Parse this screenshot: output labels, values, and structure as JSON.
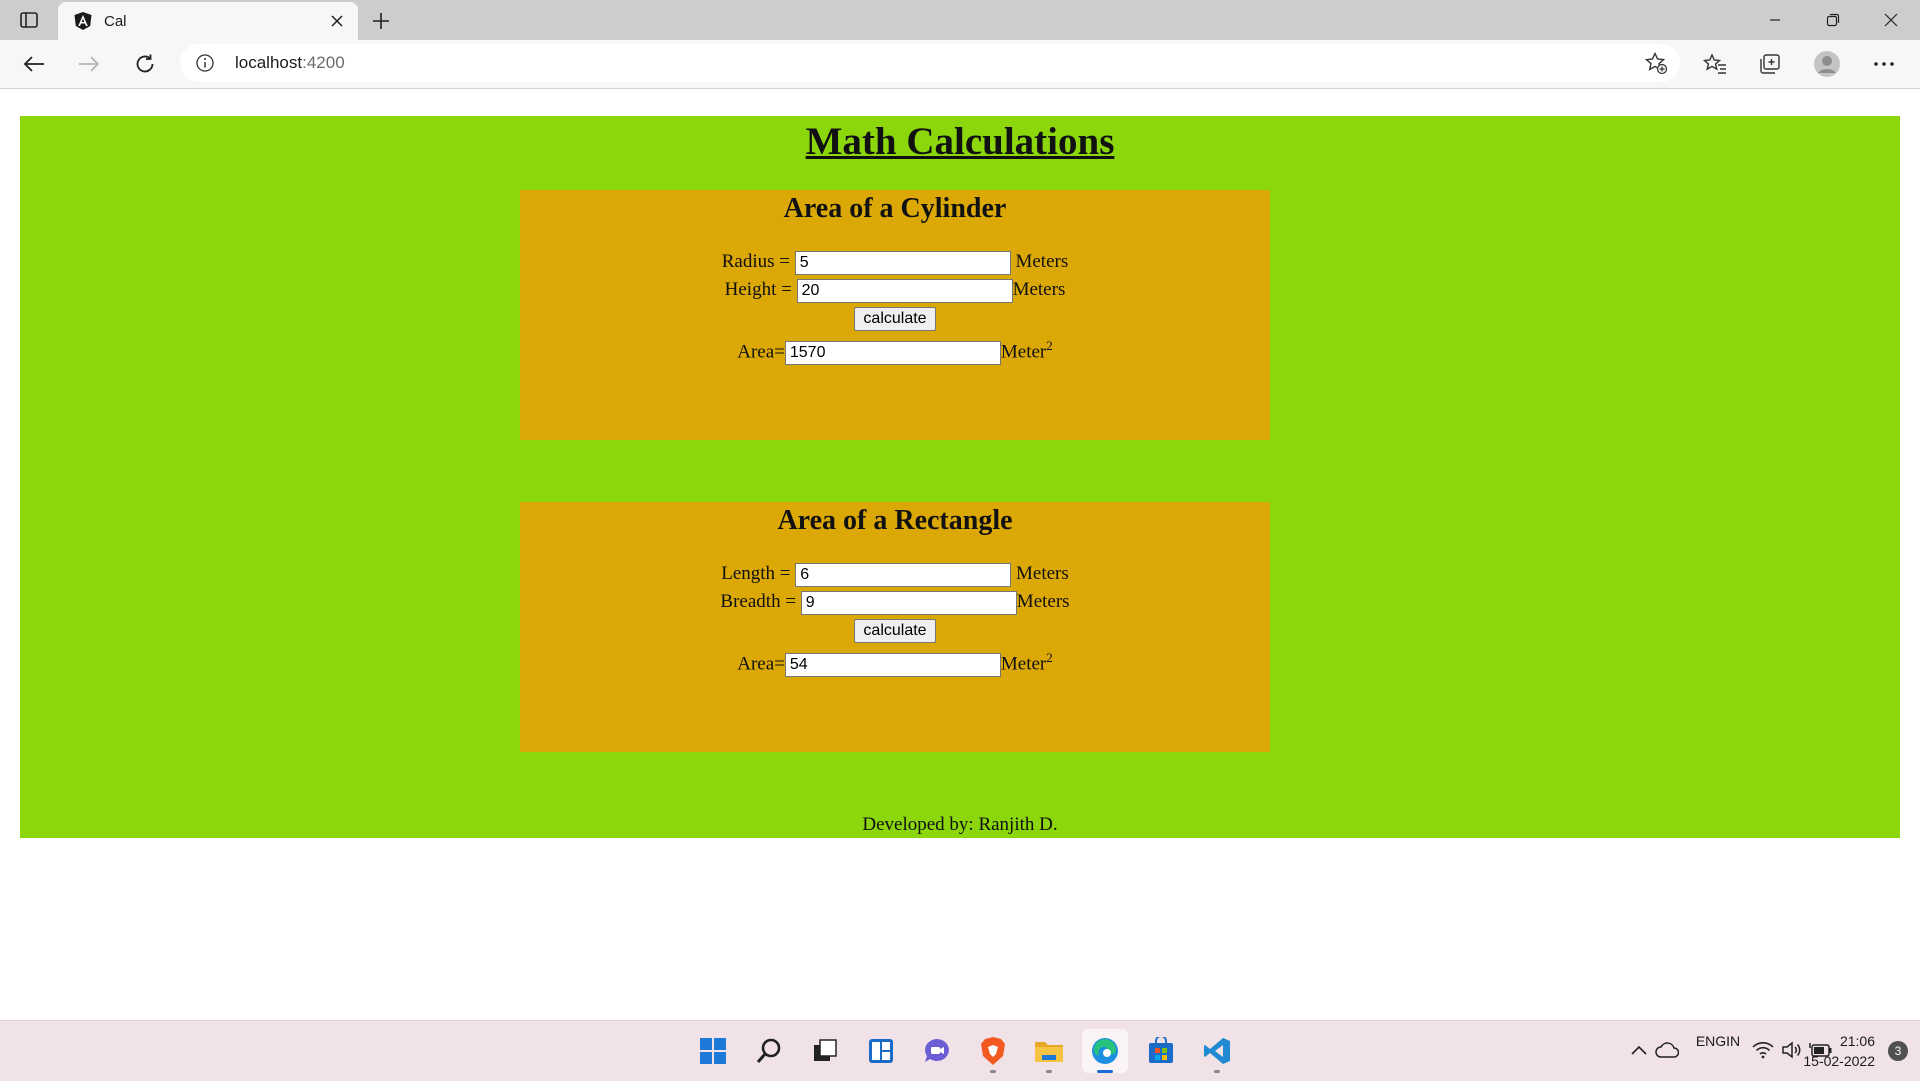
{
  "browser": {
    "tab_title": "Cal",
    "address_host": "localhost",
    "address_port": ":4200"
  },
  "page": {
    "title": "Math Calculations",
    "cylinder": {
      "heading": "Area of a Cylinder",
      "radius_label": "Radius =",
      "radius_value": "5",
      "radius_unit": "Meters",
      "height_label": "Height =",
      "height_value": "20",
      "height_unit": "Meters",
      "button_label": "calculate",
      "area_label": "Area=",
      "area_value": "1570",
      "area_unit": "Meter",
      "area_unit_exp": "2"
    },
    "rectangle": {
      "heading": "Area of a Rectangle",
      "length_label": "Length =",
      "length_value": "6",
      "length_unit": "Meters",
      "breadth_label": "Breadth =",
      "breadth_value": "9",
      "breadth_unit": "Meters",
      "button_label": "calculate",
      "area_label": "Area=",
      "area_value": "54",
      "area_unit": "Meter",
      "area_unit_exp": "2"
    },
    "footer": "Developed by: Ranjith D."
  },
  "taskbar": {
    "apps": [
      "start-icon",
      "search-icon",
      "task-view-icon",
      "widgets-icon",
      "chat-icon",
      "brave-icon",
      "file-explorer-icon",
      "edge-icon",
      "store-icon",
      "vscode-icon"
    ],
    "lang_top": "ENG",
    "lang_bottom": "IN",
    "time": "21:06",
    "date": "15-02-2022",
    "notification_count": "3"
  },
  "colors": {
    "page_bg": "#8bd70b",
    "card_bg": "#dba806",
    "edge_blue": "#1c6bd6"
  }
}
